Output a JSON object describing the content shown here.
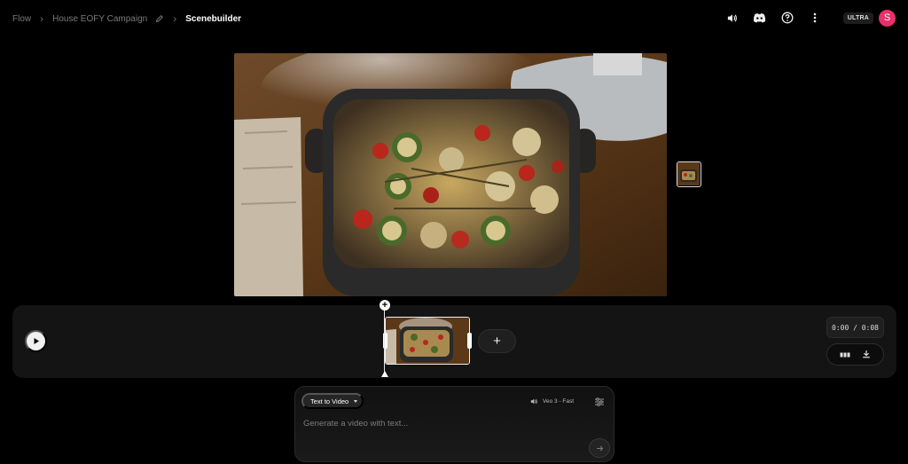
{
  "breadcrumb": {
    "items": [
      "Flow",
      "House EOFY Campaign"
    ],
    "current": "Scenebuilder",
    "separator": "›",
    "edit_icon": "pencil-icon"
  },
  "header": {
    "icons": [
      "speaker-icon",
      "discord-icon",
      "help-icon",
      "more-vert-icon"
    ],
    "plan_badge": "ULTRA",
    "avatar_initial": "S",
    "avatar_color": "#e8306a"
  },
  "preview": {
    "description_icon": "video-frame",
    "thumbnail_icon": "scene-thumbnail-icon"
  },
  "timeline": {
    "play_icon": "play-icon",
    "add_clip_label": "+",
    "timecode": "0:00 / 0:08",
    "tool_icons": [
      "frames-icon",
      "download-icon"
    ]
  },
  "prompt": {
    "mode_label": "Text to Video",
    "model_label": "Veo 3 - Fast",
    "placeholder": "Generate a video with text...",
    "send_icon": "arrow-right-icon"
  },
  "colors": {
    "background": "#000000",
    "panel": "#141414",
    "accent_pink": "#e8306a"
  }
}
